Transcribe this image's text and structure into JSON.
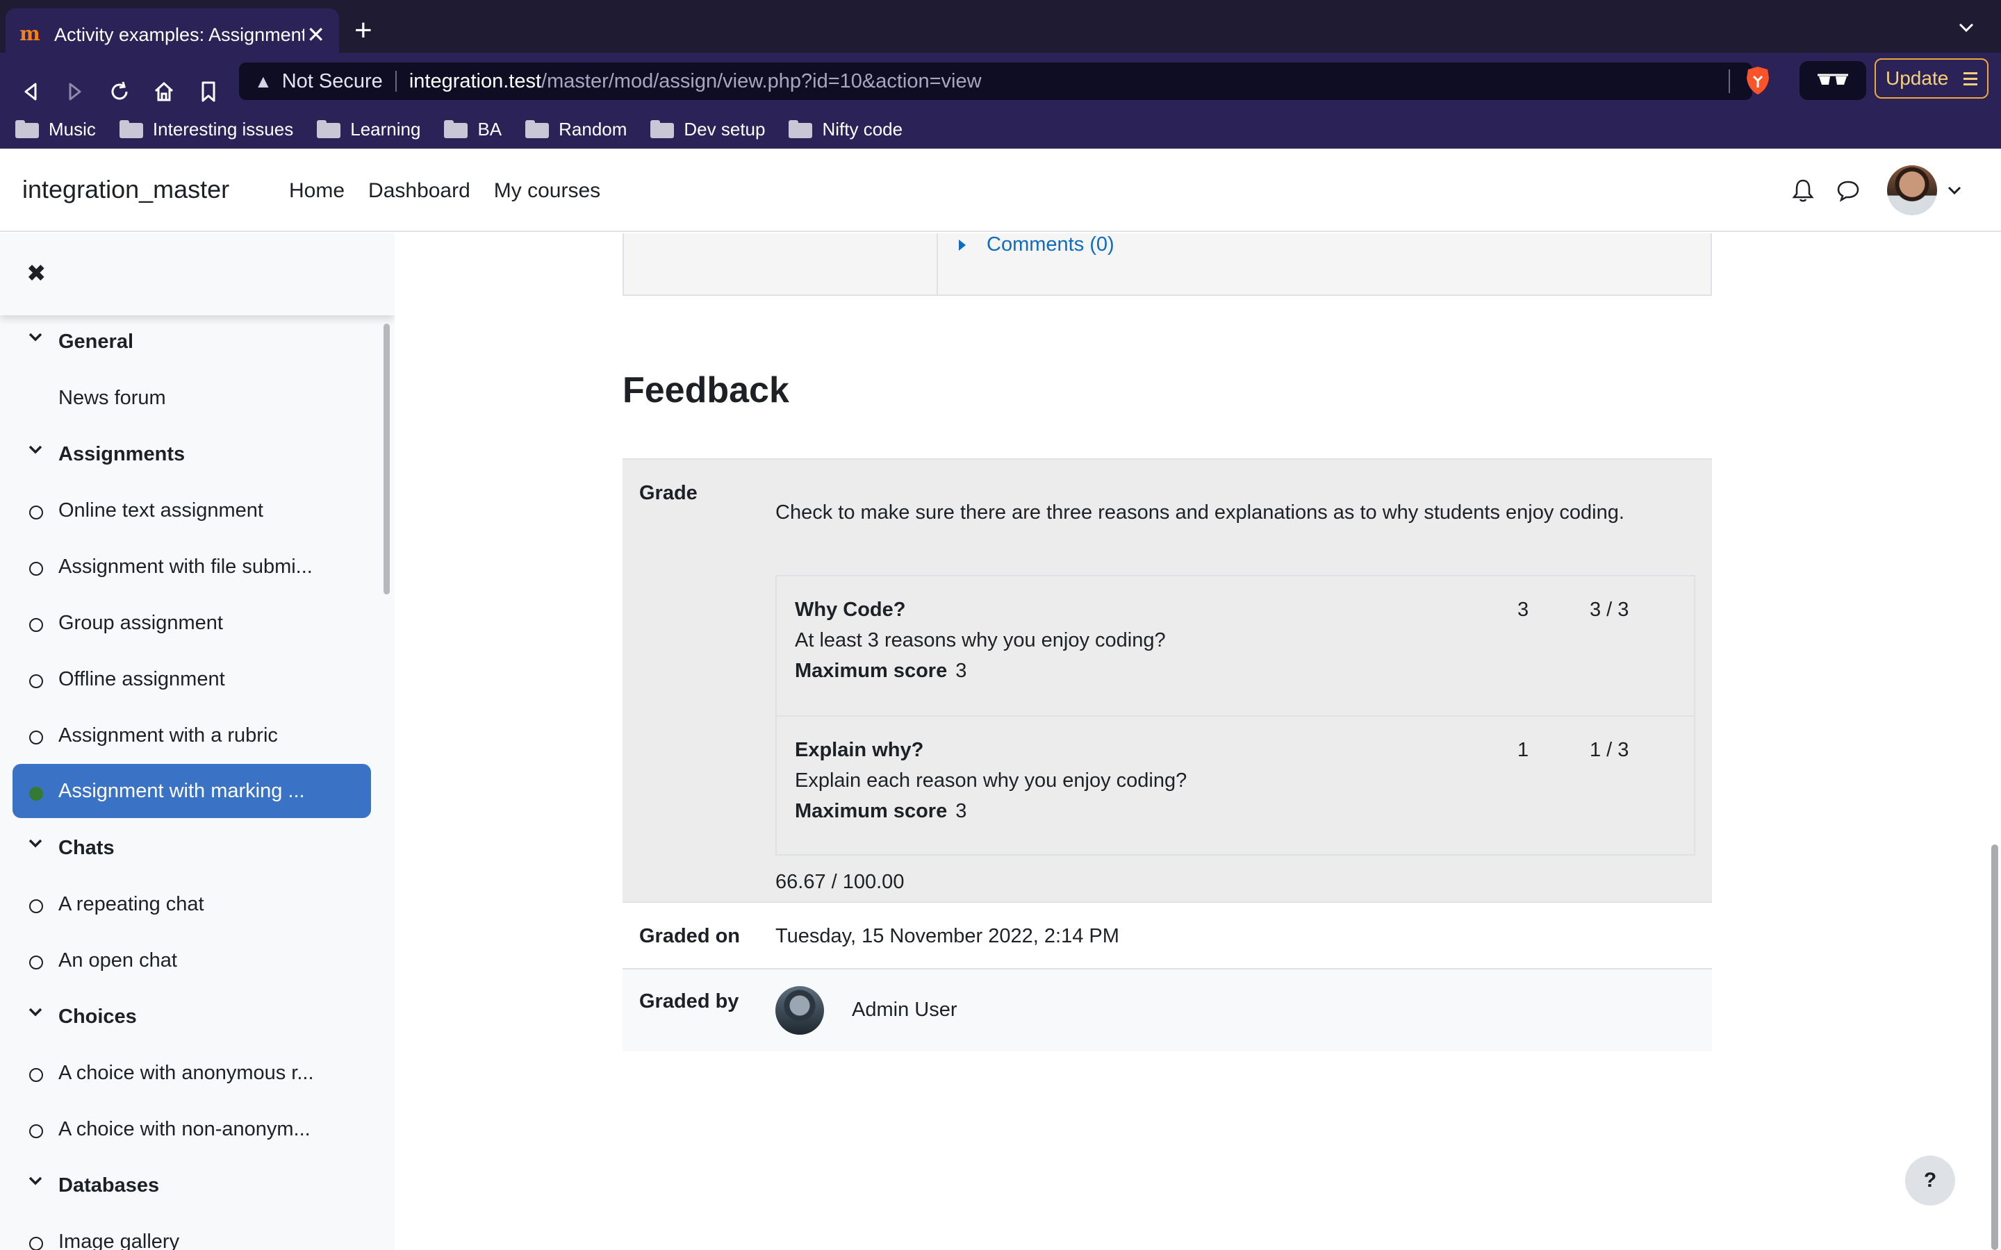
{
  "browser": {
    "tab_title": "Activity examples: Assignment",
    "url_security": "Not Secure",
    "url_host": "integration.test",
    "url_path": "/master/mod/assign/view.php?id=10&action=view",
    "update_label": "Update",
    "bookmarks": [
      "Music",
      "Interesting issues",
      "Learning",
      "BA",
      "Random",
      "Dev setup",
      "Nifty code"
    ],
    "accent": "#2b2357"
  },
  "site": {
    "name": "integration_master",
    "nav": [
      "Home",
      "Dashboard",
      "My courses"
    ]
  },
  "course_index": {
    "items": [
      {
        "type": "section",
        "label": "General"
      },
      {
        "type": "plain",
        "label": "News forum"
      },
      {
        "type": "section",
        "label": "Assignments"
      },
      {
        "type": "item",
        "label": "Online text assignment"
      },
      {
        "type": "item",
        "label": "Assignment with file submi..."
      },
      {
        "type": "item",
        "label": "Group assignment"
      },
      {
        "type": "item",
        "label": "Offline assignment"
      },
      {
        "type": "item",
        "label": "Assignment with a rubric"
      },
      {
        "type": "active",
        "label": "Assignment with marking ..."
      },
      {
        "type": "section",
        "label": "Chats"
      },
      {
        "type": "item",
        "label": "A repeating chat"
      },
      {
        "type": "item",
        "label": "An open chat"
      },
      {
        "type": "section",
        "label": "Choices"
      },
      {
        "type": "item",
        "label": "A choice with anonymous r..."
      },
      {
        "type": "item",
        "label": "A choice with non-anonym..."
      },
      {
        "type": "section",
        "label": "Databases"
      },
      {
        "type": "item",
        "label": "Image gallery"
      }
    ],
    "active_color": "#3a72c6"
  },
  "main": {
    "comments_link": "Comments (0)",
    "feedback_title": "Feedback",
    "grade_label": "Grade",
    "grade_description": "Check to make sure there are three reasons and explanations as to why students enjoy coding.",
    "criteria": [
      {
        "name": "Why Code?",
        "description": "At least 3 reasons why you enjoy coding?",
        "max_label": "Maximum score",
        "max_value": "3",
        "score": "3",
        "out_of": "3 / 3"
      },
      {
        "name": "Explain why?",
        "description": "Explain each reason why you enjoy coding?",
        "max_label": "Maximum score",
        "max_value": "3",
        "score": "1",
        "out_of": "1 / 3"
      }
    ],
    "grade_total": "66.67 / 100.00",
    "graded_on_label": "Graded on",
    "graded_on_value": "Tuesday, 15 November 2022, 2:14 PM",
    "graded_by_label": "Graded by",
    "graded_by_value": "Admin User",
    "help_label": "?"
  }
}
